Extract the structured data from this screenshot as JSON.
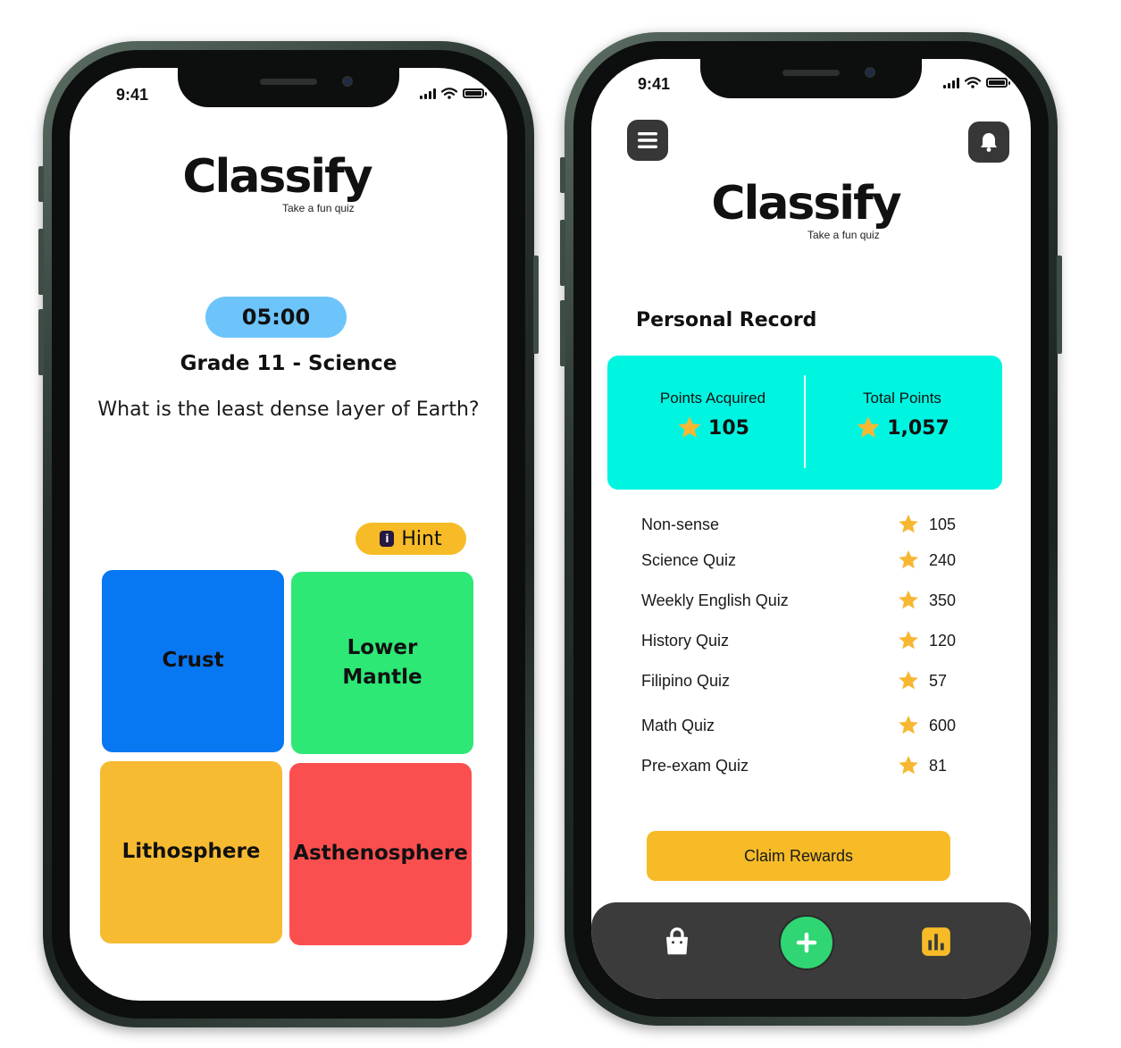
{
  "colors": {
    "timer": "#6cc4fb",
    "hint": "#f6bb27",
    "answer_1": "#0877f2",
    "answer_2": "#2de875",
    "answer_3": "#f7bb31",
    "answer_4": "#fb4f4f",
    "points_card": "#00f5e1",
    "claim_button": "#f6bb27",
    "star": "#f7b733",
    "add_button": "#2fd673",
    "bottom_bar": "#3b3b3b"
  },
  "quiz_screen": {
    "status": {
      "time": "9:41"
    },
    "brand": {
      "name": "Classify",
      "tagline": "Take a fun quiz"
    },
    "timer": "05:00",
    "subject": "Grade 11 - Science",
    "question": "What is the least dense layer of Earth?",
    "hint": {
      "icon": "info-icon",
      "icon_glyph": "i",
      "label": "Hint"
    },
    "answers": [
      {
        "label": "Crust",
        "color": "#0877f2"
      },
      {
        "label": "Lower\nMantle",
        "color": "#2de875"
      },
      {
        "label": "Lithosphere",
        "color": "#f7bb31"
      },
      {
        "label": "Asthenosphere",
        "color": "#fb4f4f"
      }
    ]
  },
  "records_screen": {
    "status": {
      "time": "9:41"
    },
    "header": {
      "menu_icon": "menu-icon",
      "bell_icon": "bell-icon"
    },
    "brand": {
      "name": "Classify",
      "tagline": "Take a fun quiz"
    },
    "section_title": "Personal Record",
    "points": {
      "acquired_label": "Points Acquired",
      "acquired_value": "105",
      "total_label": "Total Points",
      "total_value": "1,057"
    },
    "records": [
      {
        "name": "Non-sense",
        "score": "105"
      },
      {
        "name": "Science Quiz",
        "score": "240"
      },
      {
        "name": "Weekly English Quiz",
        "score": "350"
      },
      {
        "name": "History Quiz",
        "score": "120"
      },
      {
        "name": "Filipino Quiz",
        "score": "57"
      },
      {
        "name": "Math Quiz",
        "score": "600"
      },
      {
        "name": "Pre-exam Quiz",
        "score": "81"
      }
    ],
    "claim_label": "Claim Rewards",
    "bottom_nav": [
      {
        "icon": "shopping-bag-icon"
      },
      {
        "icon": "plus-icon"
      },
      {
        "icon": "bar-chart-icon"
      }
    ]
  }
}
